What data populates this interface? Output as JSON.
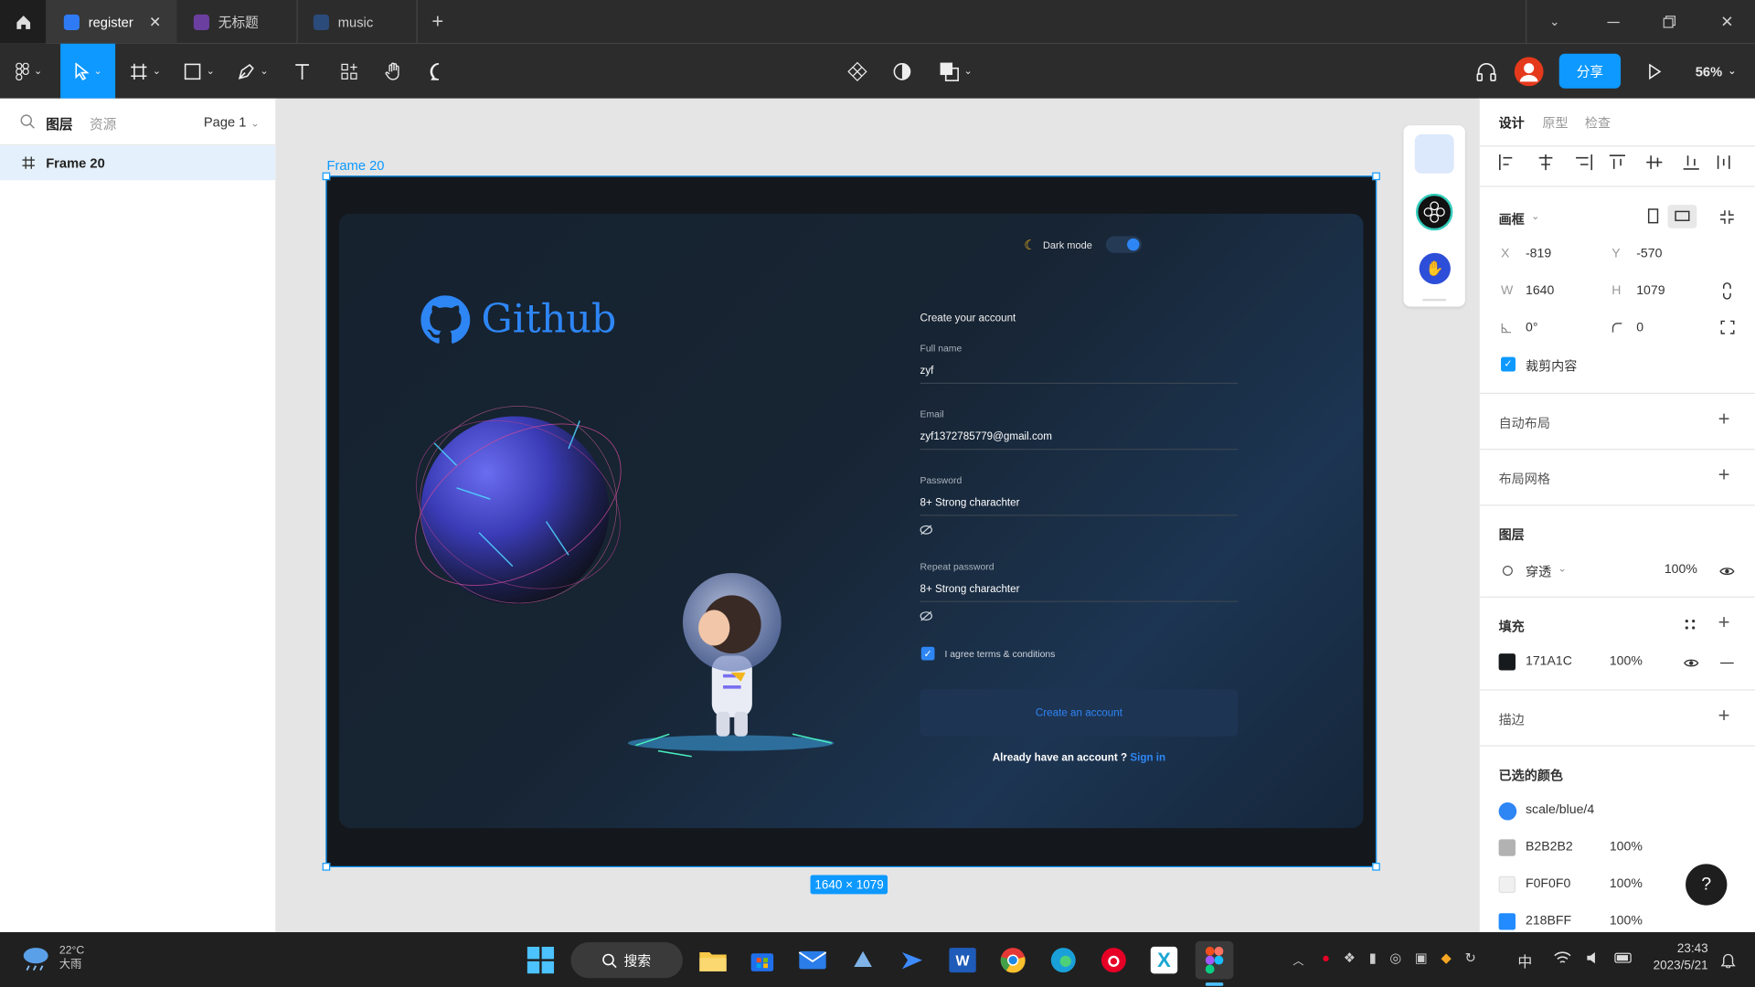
{
  "tabs": [
    {
      "label": "register",
      "color": "#2f7bf5"
    },
    {
      "label": "无标题",
      "color": "#6b3fa0"
    },
    {
      "label": "music",
      "color": "#2b4b7a"
    }
  ],
  "toolbar": {
    "share_label": "分享",
    "zoom": "56%"
  },
  "left_panel": {
    "tab_layers": "图层",
    "tab_assets": "资源",
    "page_label": "Page 1",
    "layer_name": "Frame 20"
  },
  "canvas": {
    "frame_title": "Frame 20",
    "frame_size": "1640 × 1079",
    "design": {
      "dark_mode_label": "Dark mode",
      "brand": "Github",
      "heading": "Create your account",
      "fields": [
        {
          "label": "Full name",
          "value": "zyf"
        },
        {
          "label": "Email",
          "value": "zyf1372785779@gmail.com"
        },
        {
          "label": "Password",
          "value": "8+ Strong charachter"
        },
        {
          "label": "Repeat password",
          "value": "8+ Strong charachter"
        }
      ],
      "terms_label": "I agree terms & conditions",
      "create_button": "Create an account",
      "have_account": "Already have an account ?",
      "sign_in": "Sign in"
    }
  },
  "right_panel": {
    "tabs": [
      "设计",
      "原型",
      "检查"
    ],
    "frame_label": "画框",
    "x_label": "X",
    "x": "-819",
    "y_label": "Y",
    "y": "-570",
    "w_label": "W",
    "w": "1640",
    "h_label": "H",
    "h": "1079",
    "rotation": "0°",
    "radius": "0",
    "clip_label": "裁剪内容",
    "auto_layout": "自动布局",
    "layout_grid": "布局网格",
    "layer_title": "图层",
    "blend_mode": "穿透",
    "layer_opacity": "100%",
    "fill_title": "填充",
    "fill_hex": "171A1C",
    "fill_opacity": "100%",
    "stroke_title": "描边",
    "selected_colors_title": "已选的颜色",
    "selected_colors": [
      {
        "name": "scale/blue/4",
        "opacity": "",
        "swatch": "#2e86f5"
      },
      {
        "name": "B2B2B2",
        "opacity": "100%",
        "swatch": "#b2b2b2"
      },
      {
        "name": "F0F0F0",
        "opacity": "100%",
        "swatch": "#f0f0f0"
      },
      {
        "name": "218BFF",
        "opacity": "100%",
        "swatch": "#218bff"
      }
    ],
    "help": "?"
  },
  "taskbar": {
    "weather_temp": "22°C",
    "weather_desc": "大雨",
    "search_label": "搜索",
    "ime": "中",
    "time": "23:43",
    "date": "2023/5/21"
  },
  "colors": {
    "accent": "#0d99ff",
    "dark_bg": "#2c2c2c",
    "frame_bg": "#171a1c",
    "brand_blue": "#2e86f5"
  }
}
